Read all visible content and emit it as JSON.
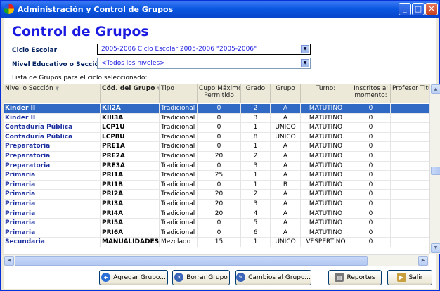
{
  "window": {
    "title": "Administración y Control de Grupos",
    "min": "_",
    "max": "□",
    "close": "✕"
  },
  "heading": "Control de Grupos",
  "ciclo": {
    "label": "Ciclo Escolar",
    "value": "2005-2006 Ciclo Escolar 2005-2006 \"2005-2006\""
  },
  "nivel": {
    "label": "Nivel Educativo o Sección",
    "value": "<Todos los niveles>"
  },
  "list_label": "Lista de Grupos para el ciclo seleccionado:",
  "columns": {
    "nivel": "Nivel o Sección",
    "cod": "Cód. del Grupo",
    "tipo": "Tipo",
    "cupo1": "Cupo Máximo",
    "cupo2": "Permitido",
    "grado": "Grado",
    "grupo": "Grupo",
    "turno": "Turno:",
    "inscritos1": "Inscritos al",
    "inscritos2": "momento:",
    "profesor": "Profesor Titular"
  },
  "rows": [
    {
      "nivel": "Kinder II",
      "cod": "KII2A",
      "tipo": "Tradicional",
      "cupo": "0",
      "grado": "2",
      "grupo": "A",
      "turno": "MATUTINO",
      "inscritos": "0",
      "selected": true
    },
    {
      "nivel": "Kinder II",
      "cod": "KIII3A",
      "tipo": "Tradicional",
      "cupo": "0",
      "grado": "3",
      "grupo": "A",
      "turno": "MATUTINO",
      "inscritos": "0"
    },
    {
      "nivel": "Contaduría Pública",
      "cod": "LCP1U",
      "tipo": "Tradicional",
      "cupo": "0",
      "grado": "1",
      "grupo": "UNICO",
      "turno": "MATUTINO",
      "inscritos": "0"
    },
    {
      "nivel": "Contaduría Pública",
      "cod": "LCP8U",
      "tipo": "Tradicional",
      "cupo": "0",
      "grado": "8",
      "grupo": "UNICO",
      "turno": "MATUTINO",
      "inscritos": "0"
    },
    {
      "nivel": "Preparatoria",
      "cod": "PRE1A",
      "tipo": "Tradicional",
      "cupo": "0",
      "grado": "1",
      "grupo": "A",
      "turno": "MATUTINO",
      "inscritos": "0"
    },
    {
      "nivel": "Preparatoria",
      "cod": "PRE2A",
      "tipo": "Tradicional",
      "cupo": "20",
      "grado": "2",
      "grupo": "A",
      "turno": "MATUTINO",
      "inscritos": "0"
    },
    {
      "nivel": "Preparatoria",
      "cod": "PRE3A",
      "tipo": "Tradicional",
      "cupo": "0",
      "grado": "3",
      "grupo": "A",
      "turno": "MATUTINO",
      "inscritos": "0"
    },
    {
      "nivel": "Primaria",
      "cod": "PRI1A",
      "tipo": "Tradicional",
      "cupo": "25",
      "grado": "1",
      "grupo": "A",
      "turno": "MATUTINO",
      "inscritos": "0"
    },
    {
      "nivel": "Primaria",
      "cod": "PRI1B",
      "tipo": "Tradicional",
      "cupo": "0",
      "grado": "1",
      "grupo": "B",
      "turno": "MATUTINO",
      "inscritos": "0"
    },
    {
      "nivel": "Primaria",
      "cod": "PRI2A",
      "tipo": "Tradicional",
      "cupo": "20",
      "grado": "2",
      "grupo": "A",
      "turno": "MATUTINO",
      "inscritos": "0"
    },
    {
      "nivel": "Primaria",
      "cod": "PRI3A",
      "tipo": "Tradicional",
      "cupo": "20",
      "grado": "3",
      "grupo": "A",
      "turno": "MATUTINO",
      "inscritos": "0"
    },
    {
      "nivel": "Primaria",
      "cod": "PRI4A",
      "tipo": "Tradicional",
      "cupo": "20",
      "grado": "4",
      "grupo": "A",
      "turno": "MATUTINO",
      "inscritos": "0"
    },
    {
      "nivel": "Primaria",
      "cod": "PRI5A",
      "tipo": "Tradicional",
      "cupo": "0",
      "grado": "5",
      "grupo": "A",
      "turno": "MATUTINO",
      "inscritos": "0"
    },
    {
      "nivel": "Primaria",
      "cod": "PRI6A",
      "tipo": "Tradicional",
      "cupo": "0",
      "grado": "6",
      "grupo": "A",
      "turno": "MATUTINO",
      "inscritos": "0"
    },
    {
      "nivel": "Secundaria",
      "cod": "MANUALIDADES",
      "tipo": "Mezclado",
      "cupo": "15",
      "grado": "1",
      "grupo": "UNICO",
      "turno": "VESPERTINO",
      "inscritos": "0"
    }
  ],
  "buttons": {
    "agregar": {
      "u": "A",
      "rest": "gregar Grupo..."
    },
    "borrar": {
      "u": "B",
      "rest": "orrar Grupo"
    },
    "cambios": {
      "u": "C",
      "rest": "ambios al Grupo..."
    },
    "reportes": {
      "u": "R",
      "rest": "eportes"
    },
    "salir": {
      "u": "S",
      "rest": "alir"
    }
  },
  "colors": {
    "accent": "#1a1ae0",
    "selection": "#316ac5",
    "titlebar": "#0a56e0"
  }
}
